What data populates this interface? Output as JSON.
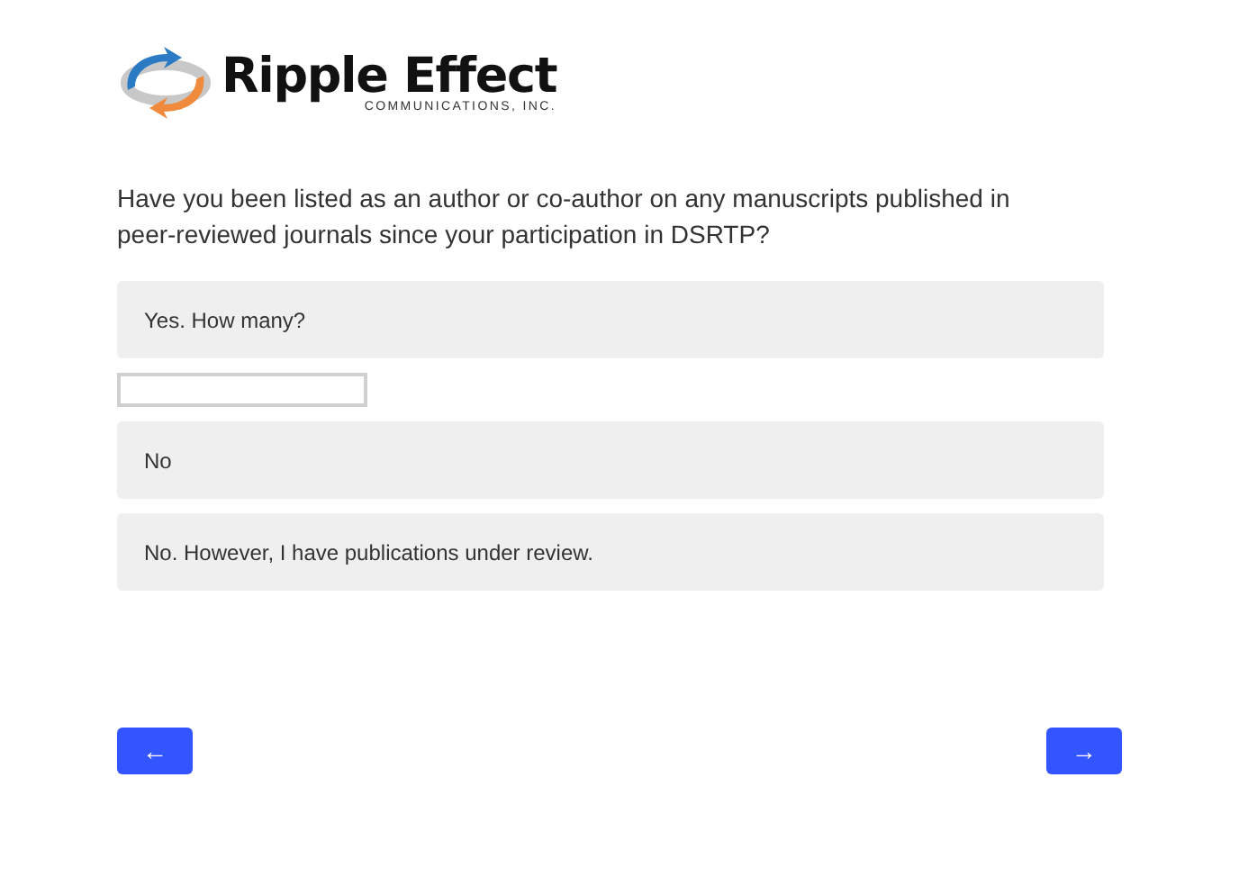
{
  "logo": {
    "name": "Ripple Effect",
    "tagline": "COMMUNICATIONS, INC."
  },
  "question": "Have you been listed as an author or co-author on any manuscripts published in peer-reviewed journals since your participation in DSRTP?",
  "answers": [
    {
      "kind": "option",
      "label": "Yes. How many?",
      "selected": false
    },
    {
      "kind": "text_field"
    },
    {
      "kind": "option",
      "label": "No",
      "selected": false
    },
    {
      "kind": "option",
      "label": "No. However, I have publications under review.",
      "selected": false
    }
  ],
  "navigation": {
    "back": "←",
    "next": "→"
  }
}
